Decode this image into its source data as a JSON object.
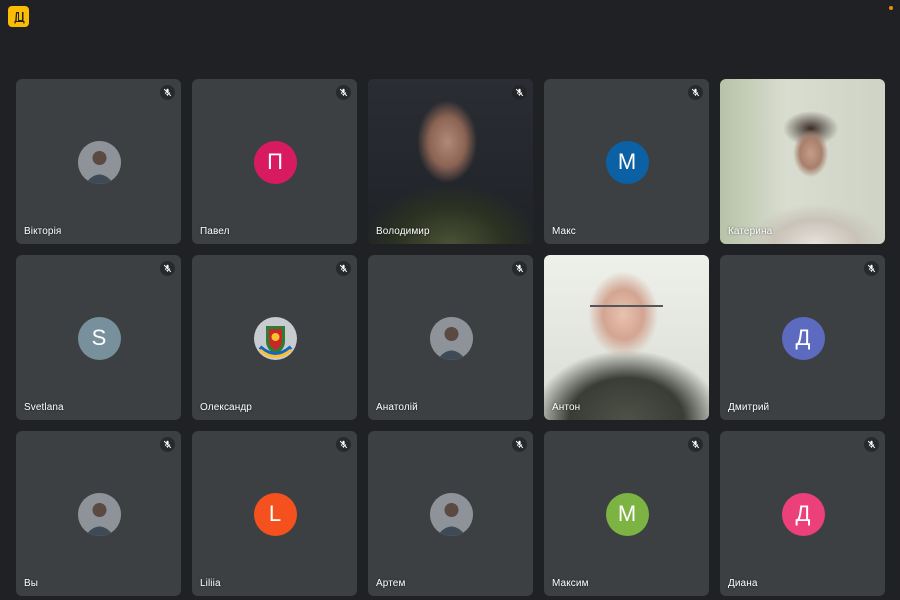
{
  "app": {
    "icon_name": "meet-grid-icon",
    "accent": "#fbbc04"
  },
  "participants": [
    {
      "name": "Вікторія",
      "muted": true,
      "kind": "photo",
      "icon": "profile-photo-avatar"
    },
    {
      "name": "Павел",
      "muted": true,
      "kind": "initial",
      "initial": "П",
      "color": "#d81b60"
    },
    {
      "name": "Володимир",
      "muted": true,
      "kind": "video"
    },
    {
      "name": "Макс",
      "muted": true,
      "kind": "initial",
      "initial": "М",
      "color": "#0b61a4"
    },
    {
      "name": "Катерина",
      "muted": false,
      "kind": "video"
    },
    {
      "name": "Svetlana",
      "muted": true,
      "kind": "initial",
      "initial": "S",
      "color": "#78909c"
    },
    {
      "name": "Олександр",
      "muted": true,
      "kind": "photo",
      "icon": "emblem-avatar"
    },
    {
      "name": "Анатолій",
      "muted": true,
      "kind": "photo",
      "icon": "profile-photo-avatar"
    },
    {
      "name": "Антон",
      "muted": false,
      "kind": "video"
    },
    {
      "name": "Дмитрий",
      "muted": true,
      "kind": "initial",
      "initial": "Д",
      "color": "#5c6bc0"
    },
    {
      "name": "Вы",
      "muted": true,
      "kind": "photo",
      "icon": "profile-photo-avatar"
    },
    {
      "name": "Liliia",
      "muted": true,
      "kind": "initial",
      "initial": "L",
      "color": "#f4511e"
    },
    {
      "name": "Артем",
      "muted": true,
      "kind": "photo",
      "icon": "profile-photo-avatar"
    },
    {
      "name": "Максим",
      "muted": true,
      "kind": "initial",
      "initial": "М",
      "color": "#7cb342"
    },
    {
      "name": "Диана",
      "muted": true,
      "kind": "initial",
      "initial": "Д",
      "color": "#ec407a"
    }
  ]
}
